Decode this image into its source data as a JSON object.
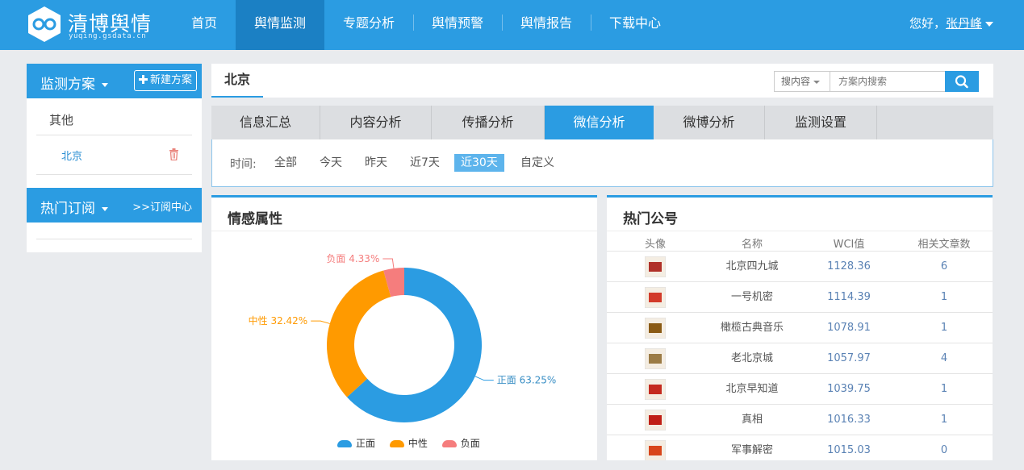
{
  "brand": {
    "title": "清博舆情",
    "subtitle": "yuqing.gsdata.cn"
  },
  "nav": [
    {
      "label": "首页",
      "active": false
    },
    {
      "label": "舆情监测",
      "active": true
    },
    {
      "label": "专题分析",
      "active": false
    },
    {
      "label": "舆情预警",
      "active": false
    },
    {
      "label": "舆情报告",
      "active": false
    },
    {
      "label": "下载中心",
      "active": false
    }
  ],
  "user": {
    "greeting": "您好，",
    "name": "张丹峰"
  },
  "sidebar": {
    "monitor_title": "监测方案",
    "new_plan_label": "新建方案",
    "group_label": "其他",
    "plan_item": "北京",
    "subscribe_title": "热门订阅",
    "subscribe_link": ">>订阅中心"
  },
  "main": {
    "title": "北京",
    "search": {
      "type_label": "搜内容",
      "placeholder": "方案内搜索"
    },
    "tabs": [
      {
        "label": "信息汇总",
        "active": false
      },
      {
        "label": "内容分析",
        "active": false
      },
      {
        "label": "传播分析",
        "active": false
      },
      {
        "label": "微信分析",
        "active": true
      },
      {
        "label": "微博分析",
        "active": false
      },
      {
        "label": "监测设置",
        "active": false
      }
    ],
    "filter": {
      "label": "时间:",
      "options": [
        {
          "label": "全部",
          "active": false
        },
        {
          "label": "今天",
          "active": false
        },
        {
          "label": "昨天",
          "active": false
        },
        {
          "label": "近7天",
          "active": false
        },
        {
          "label": "近30天",
          "active": true
        },
        {
          "label": "自定义",
          "active": false
        }
      ]
    }
  },
  "sentiment_panel": {
    "title": "情感属性"
  },
  "chart_data": {
    "type": "pie",
    "donut": true,
    "title": "情感属性",
    "series": [
      {
        "name": "正面",
        "value": 63.25,
        "label": "正面 63.25%",
        "color": "#2b9ce2"
      },
      {
        "name": "中性",
        "value": 32.42,
        "label": "中性 32.42%",
        "color": "#ff9a00"
      },
      {
        "name": "负面",
        "value": 4.33,
        "label": "负面 4.33%",
        "color": "#f57d7d"
      }
    ],
    "legend_position": "bottom"
  },
  "accounts_panel": {
    "title": "热门公号",
    "headers": [
      "头像",
      "名称",
      "WCI值",
      "相关文章数"
    ],
    "rows": [
      {
        "avatar": "avatar-beijing-sijiucheng",
        "name": "北京四九城",
        "wci": "1128.36",
        "count": "6",
        "color": "#b03028"
      },
      {
        "avatar": "avatar-yihao-jimi",
        "name": "一号机密",
        "wci": "1114.39",
        "count": "1",
        "color": "#d23a2a"
      },
      {
        "avatar": "avatar-ganlan-music",
        "name": "橄榄古典音乐",
        "wci": "1078.91",
        "count": "1",
        "color": "#8a5a14"
      },
      {
        "avatar": "avatar-lao-beijing",
        "name": "老北京城",
        "wci": "1057.97",
        "count": "4",
        "color": "#9b7b45"
      },
      {
        "avatar": "avatar-beijing-zaozhidao",
        "name": "北京早知道",
        "wci": "1039.75",
        "count": "1",
        "color": "#c42a1f"
      },
      {
        "avatar": "avatar-zhenxiang",
        "name": "真相",
        "wci": "1016.33",
        "count": "1",
        "color": "#c01f16"
      },
      {
        "avatar": "avatar-junshi-jiemi",
        "name": "军事解密",
        "wci": "1015.03",
        "count": "0",
        "color": "#d8451a"
      }
    ]
  }
}
